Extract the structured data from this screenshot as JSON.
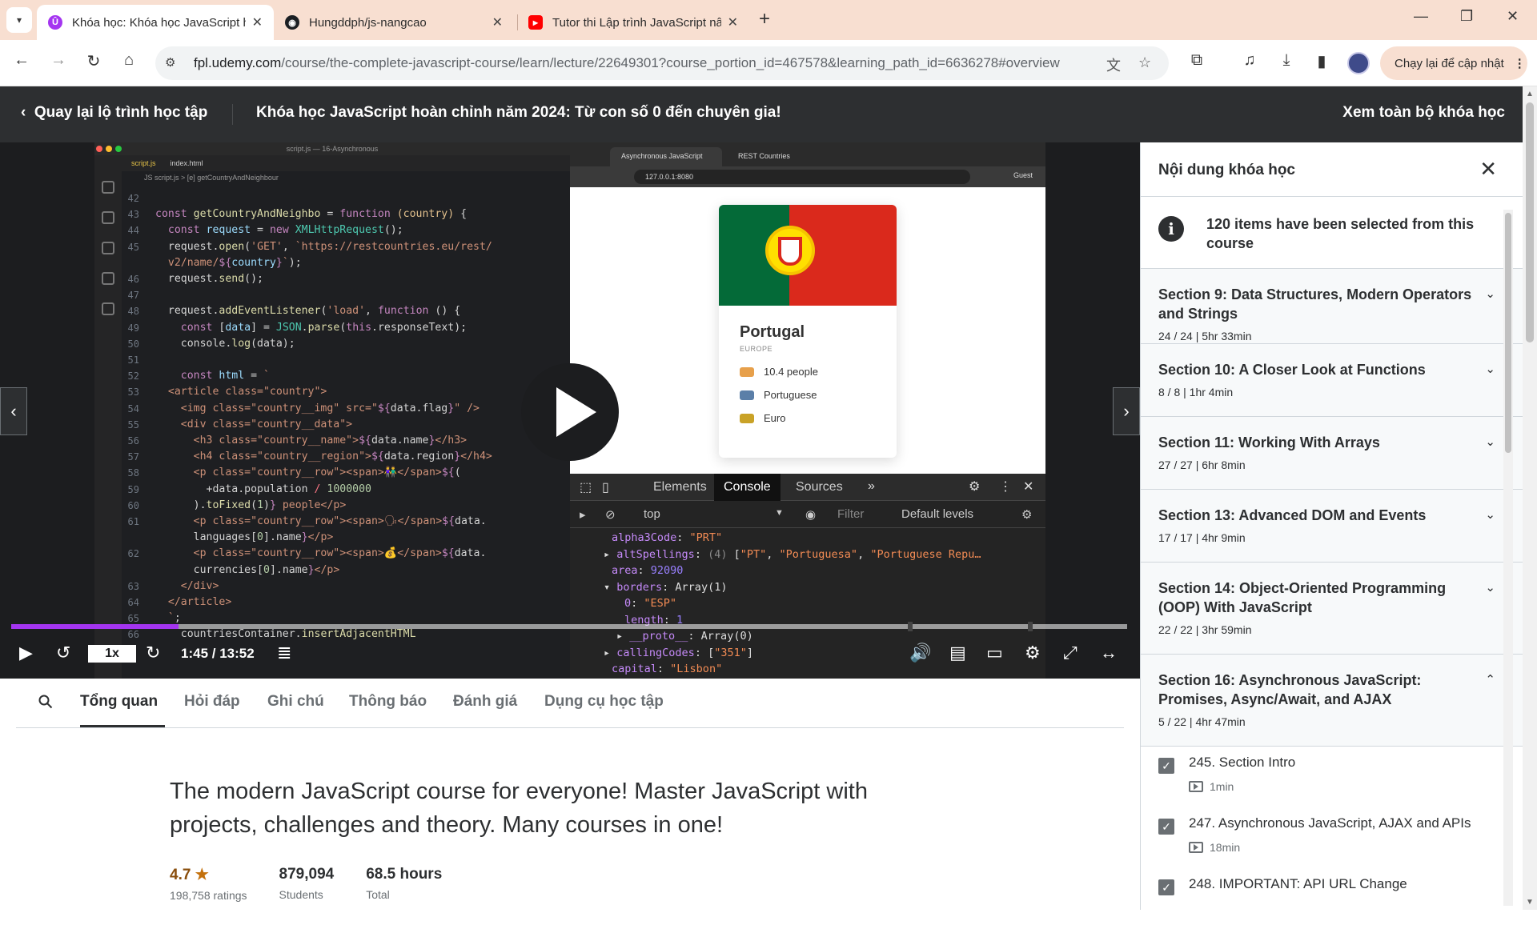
{
  "browser": {
    "tabs": [
      {
        "title": "Khóa học: Khóa học JavaScript h",
        "icon": "udemy-icon",
        "active": true
      },
      {
        "title": "Hungddph/js-nangcao",
        "icon": "github-icon",
        "active": false
      },
      {
        "title": "Tutor thi Lập trình JavaScript nâ",
        "icon": "youtube-icon",
        "active": false
      }
    ],
    "url_host": "fpl.udemy.com",
    "url_path": "/course/the-complete-javascript-course/learn/lecture/22649301?course_portion_id=467578&learning_path_id=6636278#overview",
    "update_button": "Chạy lại để cập nhật"
  },
  "header": {
    "back_label": "Quay lại lộ trình học tập",
    "course_title": "Khóa học JavaScript hoàn chỉnh năm 2024: Từ con số 0 đến chuyên gia!",
    "view_all": "Xem toàn bộ khóa học"
  },
  "video": {
    "editor_title": "script.js — 16-Asynchronous",
    "editor_tabs": [
      "script.js",
      "index.html"
    ],
    "breadcrumb": "JS script.js > [e] getCountryAndNeighbour",
    "inner_browser_tabs": [
      "Asynchronous JavaScript",
      "REST Countries"
    ],
    "inner_url": "127.0.0.1:8080",
    "inner_guest": "Guest",
    "country": {
      "name": "Portugal",
      "region": "EUROPE",
      "population": "10.4 people",
      "language": "Portuguese",
      "currency": "Euro"
    },
    "devtools_tabs": [
      "Elements",
      "Console",
      "Sources"
    ],
    "devtools_filter": {
      "context": "top",
      "filter_placeholder": "Filter",
      "levels": "Default levels"
    },
    "speed": "1x",
    "time": "1:45 / 13:52",
    "progress": 0.15
  },
  "content_tabs": [
    "Tổng quan",
    "Hỏi đáp",
    "Ghi chú",
    "Thông báo",
    "Đánh giá",
    "Dụng cụ học tập"
  ],
  "overview": {
    "headline": "The modern JavaScript course for everyone! Master JavaScript with projects, challenges and theory. Many courses in one!",
    "rating": "4.7",
    "ratings_label": "198,758 ratings",
    "students": "879,094",
    "students_label": "Students",
    "hours": "68.5 hours",
    "hours_label": "Total"
  },
  "sidebar": {
    "title": "Nội dung khóa học",
    "info": "120 items have been selected from this course",
    "sections": [
      {
        "title": "Section 9: Data Structures, Modern Operators and Strings",
        "meta": "24 / 24 | 5hr 33min"
      },
      {
        "title": "Section 10: A Closer Look at Functions",
        "meta": "8 / 8 | 1hr 4min"
      },
      {
        "title": "Section 11: Working With Arrays",
        "meta": "27 / 27 | 6hr 8min"
      },
      {
        "title": "Section 13: Advanced DOM and Events",
        "meta": "17 / 17 | 4hr 9min"
      },
      {
        "title": "Section 14: Object-Oriented Programming (OOP) With JavaScript",
        "meta": "22 / 22 | 3hr 59min"
      },
      {
        "title": "Section 16: Asynchronous JavaScript: Promises, Async/Await, and AJAX",
        "meta": "5 / 22 | 4hr 47min"
      }
    ],
    "lectures": [
      {
        "title": "245. Section Intro",
        "duration": "1min"
      },
      {
        "title": "247. Asynchronous JavaScript, AJAX and APIs",
        "duration": "18min"
      },
      {
        "title": "248. IMPORTANT: API URL Change",
        "duration": ""
      }
    ]
  }
}
